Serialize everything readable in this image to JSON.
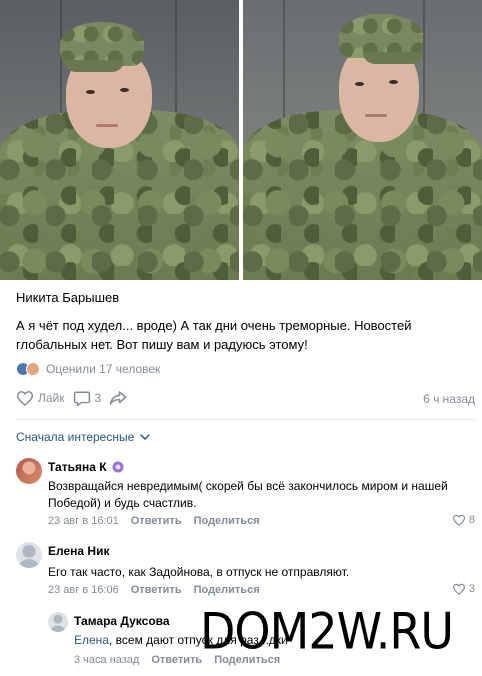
{
  "post": {
    "author": "Никита Барышев",
    "text": "А я чёт под худел... вроде) А так дни очень треморные. Новостей глобальных нет. Вот пишу вам и радуюсь этому!",
    "reactions_text": "Оценили 17 человек",
    "like_label": "Лайк",
    "comments_count": "3",
    "time_ago": "6 ч назад"
  },
  "comments_sort": {
    "label": "Сначала интересные"
  },
  "comments": [
    {
      "name": "Татьяна К",
      "text": "Возвращайся невредимым( скорей бы всё закончилось миром и нашей Победой) и будь счастлив.",
      "date": "23 авг в 16:01",
      "reply_label": "Ответить",
      "share_label": "Поделиться",
      "likes": "8"
    },
    {
      "name": "Елена Ник",
      "text": "Его так часто, как Задойнова, в отпуск не отправляют.",
      "date": "23 авг в 16:06",
      "reply_label": "Ответить",
      "share_label": "Поделиться",
      "likes": "3"
    },
    {
      "name": "Тамара Дуксова",
      "mention": "Елена",
      "text": ", всем дают отпуск для раз...дки",
      "date": "3 часа назад",
      "reply_label": "Ответить",
      "share_label": "Поделиться"
    }
  ],
  "watermark": "DOM2W.RU",
  "colors": {
    "link": "#2a5885",
    "secondary_text": "#818c99",
    "divider": "#e7e8ec"
  },
  "icons": [
    "heart-icon",
    "comment-icon",
    "share-icon",
    "chevron-down-icon",
    "verified-badge-icon"
  ]
}
